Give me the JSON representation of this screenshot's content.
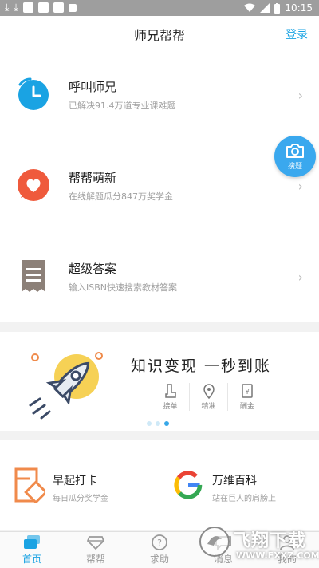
{
  "status_bar": {
    "time": "10:15"
  },
  "header": {
    "title": "师兄帮帮",
    "login": "登录"
  },
  "services": [
    {
      "title": "呼叫师兄",
      "subtitle": "已解决91.4万道专业课难题",
      "icon": "clock-icon"
    },
    {
      "title": "帮帮萌新",
      "subtitle": "在线解题瓜分847万奖学金",
      "icon": "heart-chat-icon"
    },
    {
      "title": "超级答案",
      "subtitle": "输入ISBN快速搜索教材答案",
      "icon": "receipt-icon"
    }
  ],
  "photo_search": {
    "label": "搜题",
    "icon": "camera-icon"
  },
  "banner": {
    "slogan": "知识变现 一秒到账",
    "features": [
      {
        "label": "接单",
        "icon": "seat-icon"
      },
      {
        "label": "精准",
        "icon": "location-pin-icon"
      },
      {
        "label": "酬金",
        "icon": "yen-icon"
      }
    ],
    "page_count": 3,
    "active_page": 3
  },
  "cards": [
    {
      "title": "早起打卡",
      "subtitle": "每日瓜分奖学金",
      "icon": "checkin-icon"
    },
    {
      "title": "万维百科",
      "subtitle": "站在巨人的肩膀上",
      "icon": "google-g-icon"
    }
  ],
  "tabs": [
    {
      "label": "首页",
      "icon": "home-stack-icon",
      "active": true
    },
    {
      "label": "帮帮",
      "icon": "diamond-icon",
      "active": false
    },
    {
      "label": "求助",
      "icon": "question-icon",
      "active": false
    },
    {
      "label": "消息",
      "icon": "message-icon",
      "active": false
    },
    {
      "label": "我的",
      "icon": "user-icon",
      "active": false
    }
  ],
  "watermark": {
    "title": "飞翔下载",
    "url": "WWW.FXXZ.COM"
  },
  "colors": {
    "accent": "#1aa3e3",
    "heart": "#ef5a3c",
    "card_orange": "#f08a4b"
  }
}
